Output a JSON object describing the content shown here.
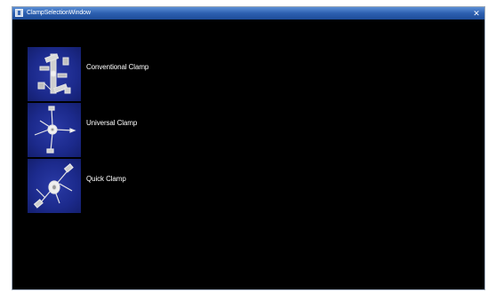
{
  "window": {
    "title": "ClampSelectionWindow",
    "close_glyph": "✕"
  },
  "clamps": [
    {
      "label": "Conventional Clamp",
      "icon": "conventional-clamp-icon"
    },
    {
      "label": "Universal Clamp",
      "icon": "universal-clamp-icon"
    },
    {
      "label": "Quick Clamp",
      "icon": "quick-clamp-icon"
    }
  ],
  "colors": {
    "window_background": "#000000",
    "thumbnail_background": "#1c2a8c",
    "titlebar": "#2c5fb0",
    "label_text": "#ffffff"
  }
}
